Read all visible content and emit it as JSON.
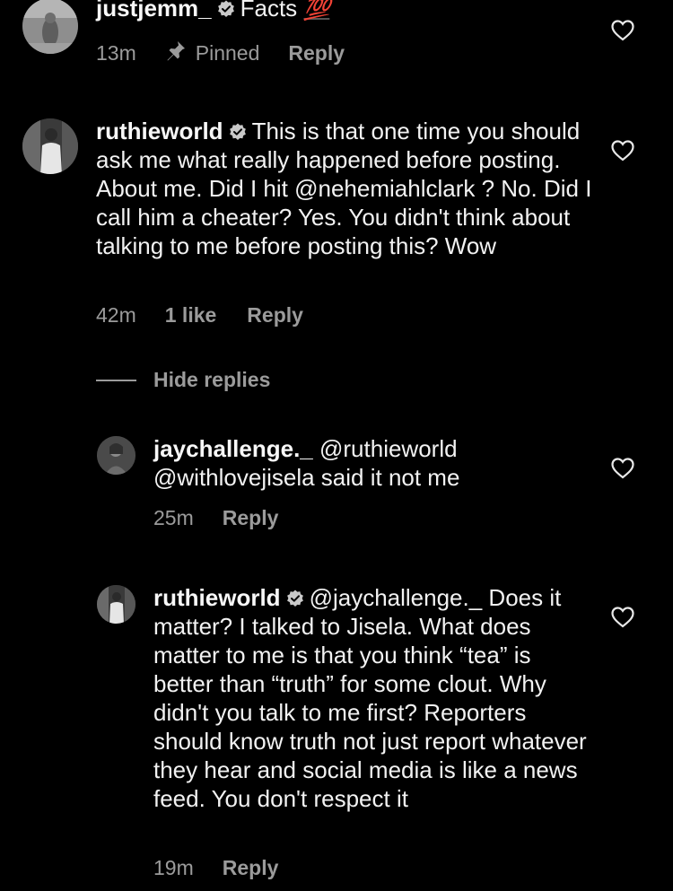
{
  "comments": [
    {
      "username": "justjemm_",
      "text": "Facts",
      "emoji": "💯",
      "time": "13m",
      "pinned_label": "Pinned",
      "reply_label": "Reply"
    },
    {
      "username": "ruthieworld",
      "text": "This is that one time you should ask me what really happened before posting. About me. Did I hit @nehemiahlclark ? No. Did I call him a cheater? Yes. You didn't think about talking to me before posting this? Wow",
      "time": "42m",
      "likes": "1 like",
      "reply_label": "Reply"
    }
  ],
  "hide_replies_label": "Hide replies",
  "replies": [
    {
      "username": "jaychallenge._",
      "text": "@ruthieworld @withlovejisela  said it not me",
      "time": "25m",
      "reply_label": "Reply"
    },
    {
      "username": "ruthieworld",
      "text": "@jaychallenge._ Does it matter? I talked to Jisela. What does matter to me is that you think “tea” is better than “truth” for some clout. Why didn't you talk to me first? Reporters should know truth not just report whatever they hear and social media is like a news feed. You don't respect it",
      "time": "19m",
      "reply_label": "Reply"
    }
  ],
  "icons": {
    "verified": "verified-badge-icon",
    "heart": "heart-icon",
    "pin": "pin-icon"
  }
}
